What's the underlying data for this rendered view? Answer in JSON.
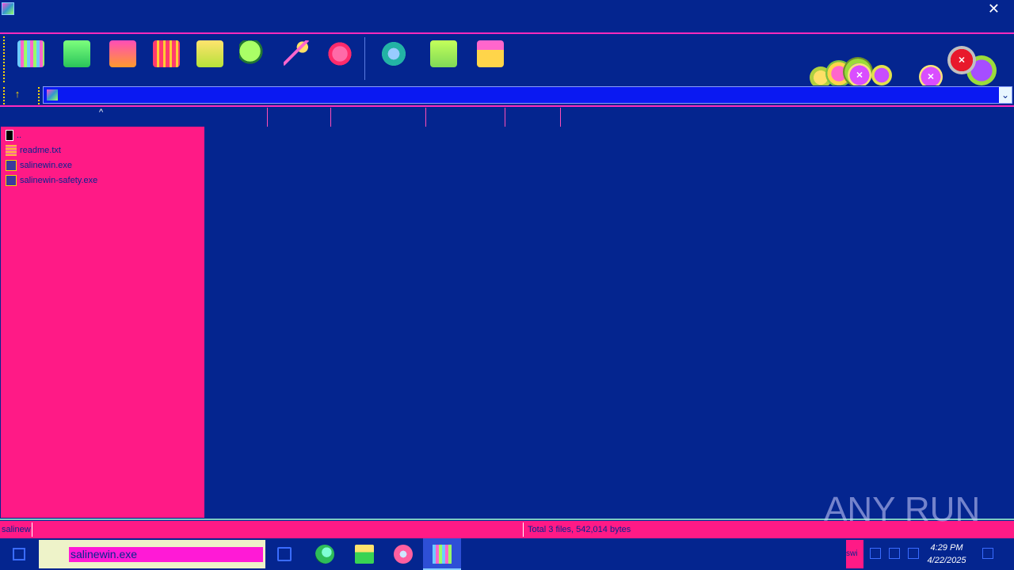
{
  "window": {
    "close_symbol": "✕"
  },
  "address": {
    "path": "",
    "dropdown_symbol": "⌄"
  },
  "tree": {
    "sort_symbol": "^",
    "items": [
      {
        "label": "..",
        "type": "parent"
      },
      {
        "label": "readme.txt",
        "type": "txt"
      },
      {
        "label": "salinewin.exe",
        "type": "exe"
      },
      {
        "label": "salinewin-safety.exe",
        "type": "exe"
      }
    ]
  },
  "status": {
    "left": "salinew",
    "right": "Total 3 files, 542,014 bytes"
  },
  "taskbar": {
    "search_value": "salinewin.exe",
    "tray_app_label": "swi",
    "clock_time": "4:29 PM",
    "clock_date": "4/22/2025"
  },
  "watermark": {
    "text": "ANY RUN"
  },
  "icons": {
    "toolbar": [
      "add-icon",
      "extract-icon",
      "test-icon",
      "view-icon",
      "delete-icon",
      "find-icon",
      "wizard-icon",
      "info-icon",
      "virusscan-icon",
      "comment-icon",
      "sfx-icon"
    ]
  }
}
